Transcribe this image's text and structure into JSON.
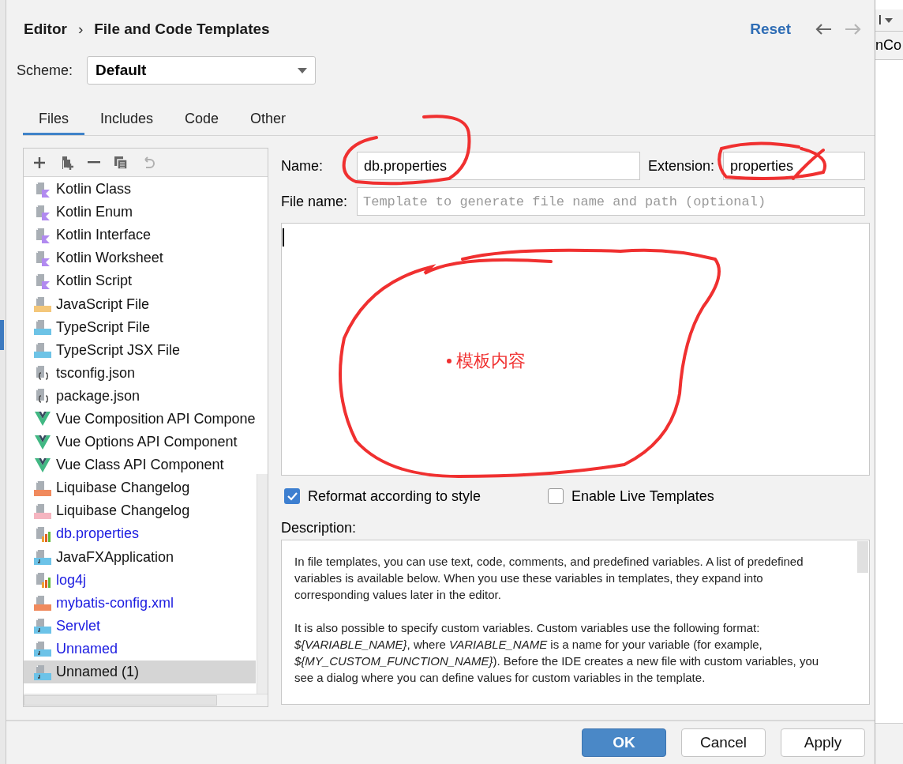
{
  "breadcrumb": {
    "parent": "Editor",
    "separator": "›",
    "current": "File and Code Templates"
  },
  "header_actions": {
    "reset": "Reset"
  },
  "scheme": {
    "label": "Scheme:",
    "value": "Default"
  },
  "tabs": [
    {
      "label": "Files",
      "selected": true
    },
    {
      "label": "Includes",
      "selected": false
    },
    {
      "label": "Code",
      "selected": false
    },
    {
      "label": "Other",
      "selected": false
    }
  ],
  "templates": [
    {
      "label": "Kotlin Class",
      "kind": "kotlin",
      "custom": false,
      "selected": false
    },
    {
      "label": "Kotlin Enum",
      "kind": "kotlin",
      "custom": false,
      "selected": false
    },
    {
      "label": "Kotlin Interface",
      "kind": "kotlin",
      "custom": false,
      "selected": false
    },
    {
      "label": "Kotlin Worksheet",
      "kind": "kotlin",
      "custom": false,
      "selected": false
    },
    {
      "label": "Kotlin Script",
      "kind": "kotlin",
      "custom": false,
      "selected": false
    },
    {
      "label": "JavaScript File",
      "kind": "js",
      "custom": false,
      "selected": false
    },
    {
      "label": "TypeScript File",
      "kind": "ts",
      "custom": false,
      "selected": false
    },
    {
      "label": "TypeScript JSX File",
      "kind": "ts",
      "custom": false,
      "selected": false
    },
    {
      "label": "tsconfig.json",
      "kind": "json",
      "custom": false,
      "selected": false
    },
    {
      "label": "package.json",
      "kind": "json",
      "custom": false,
      "selected": false
    },
    {
      "label": "Vue Composition API Compone",
      "kind": "vue",
      "custom": false,
      "selected": false
    },
    {
      "label": "Vue Options API Component",
      "kind": "vue",
      "custom": false,
      "selected": false
    },
    {
      "label": "Vue Class API Component",
      "kind": "vue",
      "custom": false,
      "selected": false
    },
    {
      "label": "Liquibase Changelog",
      "kind": "xml",
      "custom": false,
      "selected": false
    },
    {
      "label": "Liquibase Changelog",
      "kind": "yml",
      "custom": false,
      "selected": false
    },
    {
      "label": "db.properties",
      "kind": "properties",
      "custom": true,
      "selected": false
    },
    {
      "label": "JavaFXApplication",
      "kind": "java",
      "custom": false,
      "selected": false
    },
    {
      "label": "log4j",
      "kind": "properties",
      "custom": true,
      "selected": false
    },
    {
      "label": "mybatis-config.xml",
      "kind": "xml",
      "custom": true,
      "selected": false
    },
    {
      "label": "Servlet",
      "kind": "java",
      "custom": true,
      "selected": false
    },
    {
      "label": "Unnamed",
      "kind": "java",
      "custom": true,
      "selected": false
    },
    {
      "label": "Unnamed (1)",
      "kind": "java",
      "custom": false,
      "selected": true
    }
  ],
  "form": {
    "name_label": "Name:",
    "name_value": "db.properties",
    "extension_label": "Extension:",
    "extension_value": "properties",
    "file_name_label": "File name:",
    "file_name_placeholder": "Template to generate file name and path (optional)"
  },
  "options": [
    {
      "label": "Reformat according to style",
      "checked": true
    },
    {
      "label": "Enable Live Templates",
      "checked": false
    }
  ],
  "description": {
    "label": "Description:",
    "paragraphs": [
      "In file templates, you can use text, code, comments, and predefined variables. A list of predefined variables is available below. When you use these variables in templates, they expand into corresponding values later in the editor.",
      "It is also possible to specify custom variables. Custom variables use the following format: *${VARIABLE_NAME}*, where *VARIABLE_NAME* is a name for your variable (for example, *${MY_CUSTOM_FUNCTION_NAME}*). Before the IDE creates a new file with custom variables, you see a dialog where you can define values for custom variables in the template."
    ]
  },
  "buttons": [
    {
      "label": "OK",
      "kind": "primary"
    },
    {
      "label": "Cancel",
      "kind": "normal"
    },
    {
      "label": "Apply",
      "kind": "normal"
    }
  ],
  "annotation": {
    "text": "模板内容"
  },
  "background_window": {
    "dropdown": "l",
    "tab": "nCo"
  }
}
